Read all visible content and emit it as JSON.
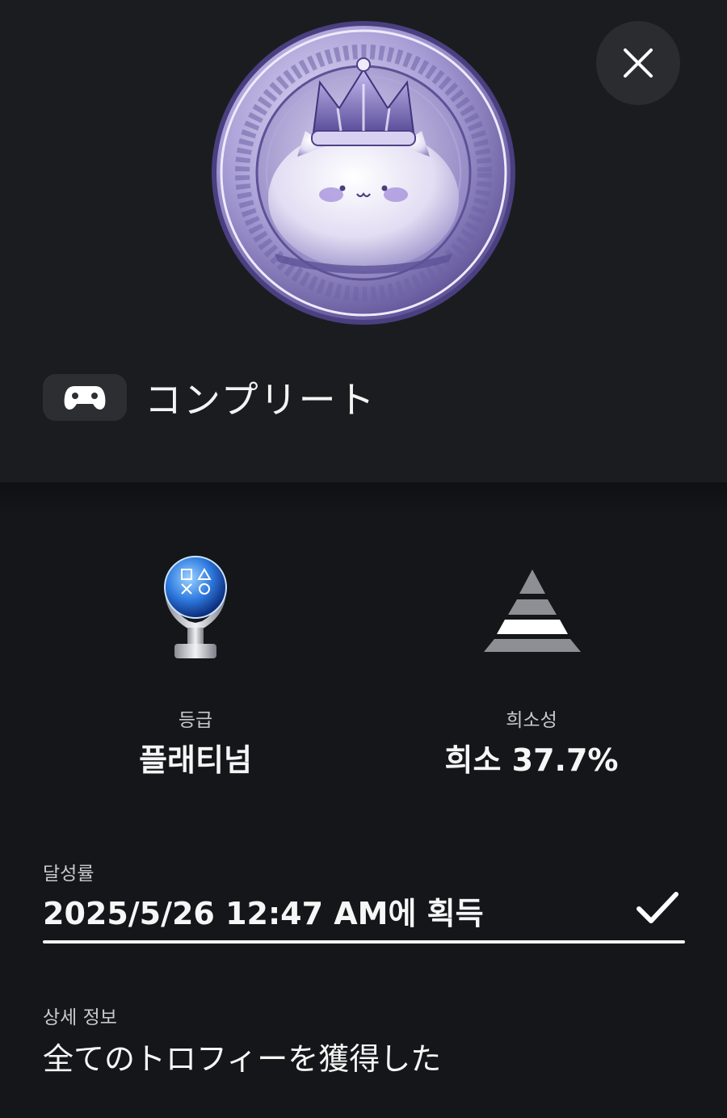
{
  "trophy": {
    "title": "コンプリート",
    "description_label": "상세 정보",
    "description": "全てのトロフィーを獲得した"
  },
  "stats": {
    "grade_label": "등급",
    "grade_value": "플래티넘",
    "rarity_label": "희소성",
    "rarity_value": "희소 37.7%",
    "rarity_percent": 37.7
  },
  "earned": {
    "label": "달성률",
    "value": "2025/5/26  12:47 AM에 획득",
    "completed": true
  },
  "icons": {
    "close": "close-icon",
    "platform": "gamepad-icon",
    "grade": "platinum-trophy-icon",
    "rarity": "rarity-pyramid-icon",
    "earned": "checkmark-icon"
  },
  "colors": {
    "background": "#151619",
    "top_section": "#1b1c1f",
    "button_bg": "#2b2c30",
    "text": "#f6f6f6",
    "secondary_text": "#c9c9cc",
    "medal_purple": "#8a7fc2",
    "platinum_blue": "#2f7be0"
  }
}
